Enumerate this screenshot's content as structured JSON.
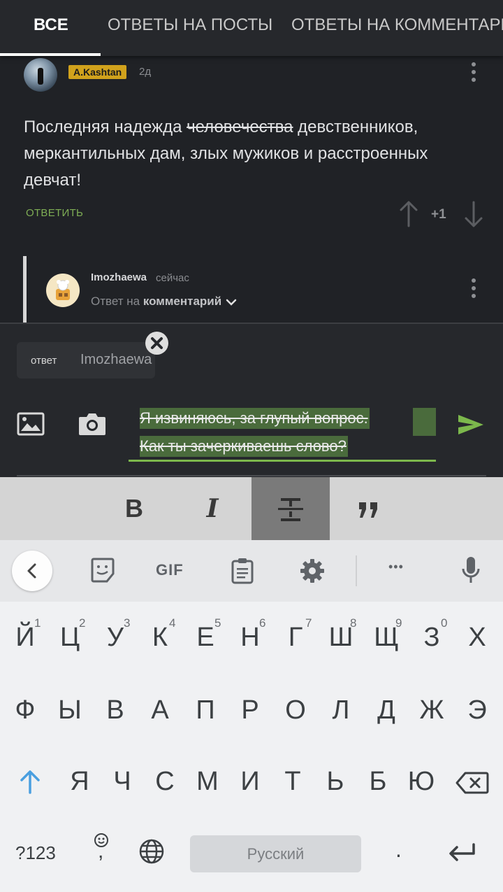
{
  "tabs": [
    "ВСЕ",
    "ОТВЕТЫ НА ПОСТЫ",
    "ОТВЕТЫ НА КОММЕНТАРИИ"
  ],
  "comment": {
    "author": "A.Kashtan",
    "time": "2д",
    "text_before": "Последняя надежда ",
    "text_struck": "человечества",
    "text_after": " девственников, меркантильных дам, злых мужиков и расстроенных девчат!",
    "reply_label": "ОТВЕТИТЬ",
    "score": "+1"
  },
  "reply": {
    "author": "Imozhaewa",
    "time": "сейчас",
    "reply_to_prefix": "Ответ на",
    "reply_to_target": "комментарий"
  },
  "composer": {
    "chip_label": "ответ",
    "chip_name": "Imozhaewa",
    "line1": "Я извиняюсь, за глупый вопрос.",
    "line2": "Как ты зачеркиваешь слово?"
  },
  "format_bar": {
    "bold": "B",
    "italic": "I",
    "strike": "∓",
    "quote": "99"
  },
  "keyboard": {
    "gif_label": "GIF",
    "dots": "•••",
    "row1": [
      "Й",
      "Ц",
      "У",
      "К",
      "Е",
      "Н",
      "Г",
      "Ш",
      "Щ",
      "З",
      "Х"
    ],
    "row1_hints": [
      "1",
      "2",
      "3",
      "4",
      "5",
      "6",
      "7",
      "8",
      "9",
      "0"
    ],
    "row2": [
      "Ф",
      "Ы",
      "В",
      "А",
      "П",
      "Р",
      "О",
      "Л",
      "Д",
      "Ж",
      "Э"
    ],
    "row3": [
      "Я",
      "Ч",
      "С",
      "М",
      "И",
      "Т",
      "Ь",
      "Б",
      "Ю"
    ],
    "sym_label": "?123",
    "comma": ",",
    "space_label": "Русский",
    "period": "."
  },
  "colors": {
    "accent_green": "#7cb84c",
    "badge_gold": "#d1a21c",
    "selection": "#4a6b3c",
    "keyboard_blue": "#4a9fe0"
  }
}
